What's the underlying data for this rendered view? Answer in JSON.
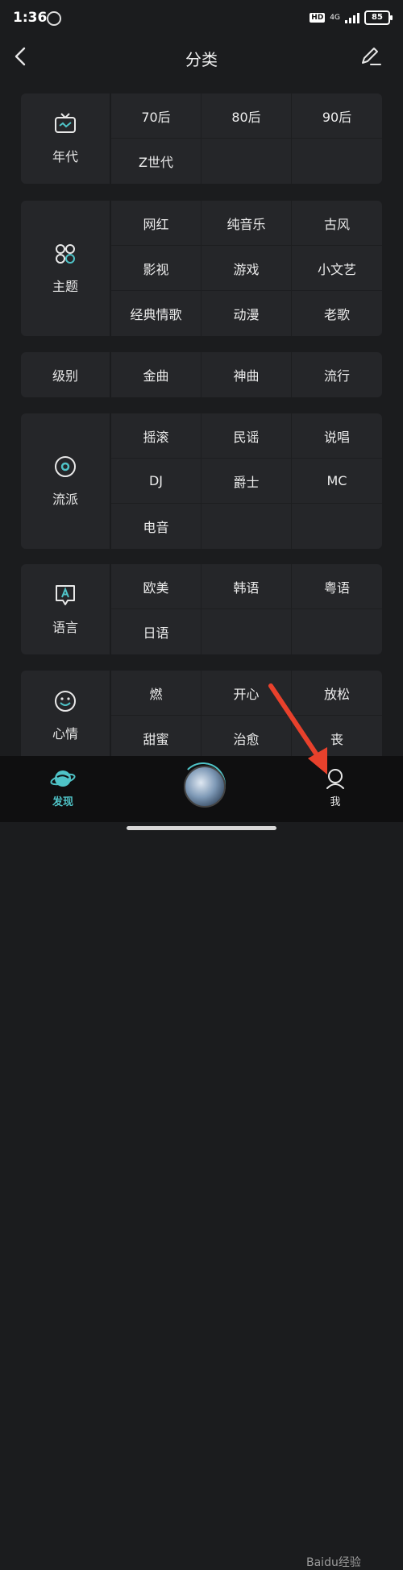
{
  "status": {
    "time": "1:36",
    "hd": "HD",
    "network": "4G",
    "battery": "85"
  },
  "header": {
    "title": "分类"
  },
  "categories": [
    {
      "label": "年代",
      "icon": "tv-icon",
      "items": [
        "70后",
        "80后",
        "90后",
        "Z世代",
        "",
        ""
      ]
    },
    {
      "label": "主题",
      "icon": "apps-icon",
      "items": [
        "网红",
        "纯音乐",
        "古风",
        "影视",
        "游戏",
        "小文艺",
        "经典情歌",
        "动漫",
        "老歌"
      ]
    },
    {
      "label": "级别",
      "icon": "",
      "items": [
        "金曲",
        "神曲",
        "流行"
      ]
    },
    {
      "label": "流派",
      "icon": "disc-icon",
      "items": [
        "摇滚",
        "民谣",
        "说唱",
        "DJ",
        "爵士",
        "MC",
        "电音",
        "",
        ""
      ]
    },
    {
      "label": "语言",
      "icon": "chat-a-icon",
      "items": [
        "欧美",
        "韩语",
        "粤语",
        "日语",
        "",
        ""
      ]
    },
    {
      "label": "心情",
      "icon": "smile-icon",
      "items": [
        "燃",
        "开心",
        "放松",
        "甜蜜",
        "治愈",
        "丧"
      ]
    }
  ],
  "tabbar": {
    "discover": "发现",
    "me": "我"
  },
  "watermark": "Baidu经验",
  "colors": {
    "accent": "#4fc3c7",
    "arrow": "#e8412c"
  }
}
